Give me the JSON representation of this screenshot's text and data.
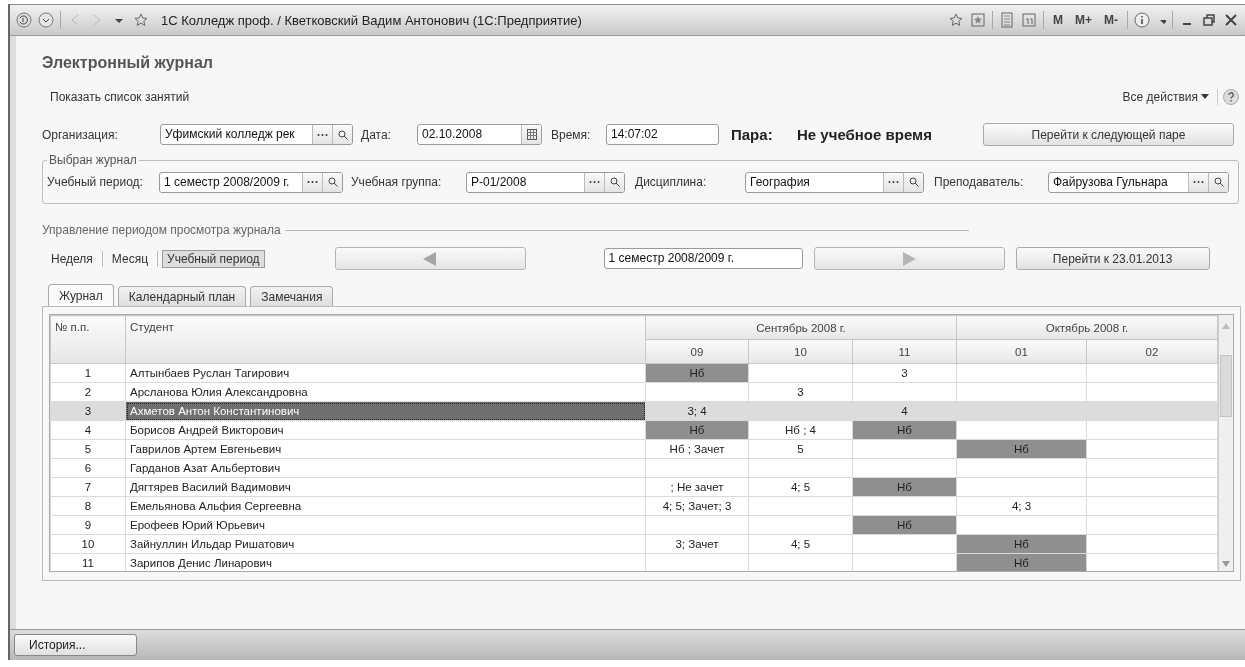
{
  "window": {
    "title": "1С Колледж проф. / Кветковский Вадим Антонович  (1С:Предприятие)",
    "memory_buttons": [
      "M",
      "M+",
      "M-"
    ]
  },
  "form": {
    "title": "Электронный журнал",
    "show_list_link": "Показать список занятий",
    "all_actions": "Все действия",
    "organization": {
      "label": "Организация:",
      "value": "Уфимский колледж рек"
    },
    "date": {
      "label": "Дата:",
      "value": "02.10.2008"
    },
    "time": {
      "label": "Время:",
      "value": "14:07:02"
    },
    "pair": {
      "label": "Пара:",
      "value": "Не учебное время"
    },
    "next_pair_button": "Перейти к следующей паре",
    "journal_group": {
      "title": "Выбран журнал",
      "fields": [
        {
          "label": "Учебный период:",
          "value": "1 семестр 2008/2009 г."
        },
        {
          "label": "Учебная группа:",
          "value": "Р-01/2008"
        },
        {
          "label": "Дисциплина:",
          "value": "География"
        },
        {
          "label": "Преподаватель:",
          "value": "Файрузова Гульнара"
        }
      ]
    },
    "period_group": {
      "title": "Управление периодом просмотра журнала",
      "modes": [
        {
          "label": "Неделя",
          "selected": false
        },
        {
          "label": "Месяц",
          "selected": false
        },
        {
          "label": "Учебный период",
          "selected": true
        }
      ],
      "period_value": "1 семестр 2008/2009 г.",
      "goto_button": "Перейти к 23.01.2013"
    },
    "tabs": [
      {
        "label": "Журнал",
        "selected": true
      },
      {
        "label": "Календарный план",
        "selected": false
      },
      {
        "label": "Замечания",
        "selected": false
      }
    ]
  },
  "grid": {
    "columns": [
      "№ п.п.",
      "Студент"
    ],
    "months": [
      {
        "label": "Сентябрь 2008 г.",
        "days": [
          "09",
          "10",
          "11"
        ]
      },
      {
        "label": "Октябрь 2008 г.",
        "days": [
          "01",
          "02"
        ]
      }
    ],
    "rows": [
      {
        "number": "1",
        "student": "Алтынбаев Руслан Тагирович",
        "selected": false,
        "cells": [
          {
            "text": "Нб",
            "highlighted": true
          },
          {
            "text": "",
            "highlighted": false
          },
          {
            "text": "3",
            "highlighted": false
          },
          {
            "text": "",
            "highlighted": false
          },
          {
            "text": "",
            "highlighted": false
          }
        ]
      },
      {
        "number": "2",
        "student": "Арсланова Юлия Александровна",
        "selected": false,
        "cells": [
          {
            "text": "",
            "highlighted": false
          },
          {
            "text": "3",
            "highlighted": false
          },
          {
            "text": "",
            "highlighted": false
          },
          {
            "text": "",
            "highlighted": false
          },
          {
            "text": "",
            "highlighted": false
          }
        ]
      },
      {
        "number": "3",
        "student": "Ахметов Антон Константинович",
        "selected": true,
        "cells": [
          {
            "text": "3; 4",
            "highlighted": false
          },
          {
            "text": "",
            "highlighted": false
          },
          {
            "text": "4",
            "highlighted": false
          },
          {
            "text": "",
            "highlighted": false
          },
          {
            "text": "",
            "highlighted": false
          }
        ]
      },
      {
        "number": "4",
        "student": "Борисов Андрей Викторович",
        "selected": false,
        "cells": [
          {
            "text": "Нб",
            "highlighted": true
          },
          {
            "text": "Нб ; 4",
            "highlighted": false
          },
          {
            "text": "Нб",
            "highlighted": true
          },
          {
            "text": "",
            "highlighted": false
          },
          {
            "text": "",
            "highlighted": false
          }
        ]
      },
      {
        "number": "5",
        "student": "Гаврилов Артем Евгеньевич",
        "selected": false,
        "cells": [
          {
            "text": "Нб ; Зачет",
            "highlighted": false
          },
          {
            "text": "5",
            "highlighted": false
          },
          {
            "text": "",
            "highlighted": false
          },
          {
            "text": "Нб",
            "highlighted": true
          },
          {
            "text": "",
            "highlighted": false
          }
        ]
      },
      {
        "number": "6",
        "student": "Гарданов Азат Альбертович",
        "selected": false,
        "cells": [
          {
            "text": "",
            "highlighted": false
          },
          {
            "text": "",
            "highlighted": false
          },
          {
            "text": "",
            "highlighted": false
          },
          {
            "text": "",
            "highlighted": false
          },
          {
            "text": "",
            "highlighted": false
          }
        ]
      },
      {
        "number": "7",
        "student": "Дягтярев Василий Вадимович",
        "selected": false,
        "cells": [
          {
            "text": "; Не зачет",
            "highlighted": false
          },
          {
            "text": "4; 5",
            "highlighted": false
          },
          {
            "text": "Нб",
            "highlighted": true
          },
          {
            "text": "",
            "highlighted": false
          },
          {
            "text": "",
            "highlighted": false
          }
        ]
      },
      {
        "number": "8",
        "student": "Емельянова Альфия Сергеевна",
        "selected": false,
        "cells": [
          {
            "text": "4; 5; Зачет; 3",
            "highlighted": false
          },
          {
            "text": "",
            "highlighted": false
          },
          {
            "text": "",
            "highlighted": false
          },
          {
            "text": "4; 3",
            "highlighted": false
          },
          {
            "text": "",
            "highlighted": false
          }
        ]
      },
      {
        "number": "9",
        "student": "Ерофеев Юрий Юрьевич",
        "selected": false,
        "cells": [
          {
            "text": "",
            "highlighted": false
          },
          {
            "text": "",
            "highlighted": false
          },
          {
            "text": "Нб",
            "highlighted": true
          },
          {
            "text": "",
            "highlighted": false
          },
          {
            "text": "",
            "highlighted": false
          }
        ]
      },
      {
        "number": "10",
        "student": "Зайнуллин Ильдар Ришатович",
        "selected": false,
        "cells": [
          {
            "text": "3; Зачет",
            "highlighted": false
          },
          {
            "text": "4; 5",
            "highlighted": false
          },
          {
            "text": "",
            "highlighted": false
          },
          {
            "text": "Нб",
            "highlighted": true
          },
          {
            "text": "",
            "highlighted": false
          }
        ]
      },
      {
        "number": "11",
        "student": "Зарипов Денис Линарович",
        "selected": false,
        "cells": [
          {
            "text": "",
            "highlighted": false
          },
          {
            "text": "",
            "highlighted": false
          },
          {
            "text": "",
            "highlighted": false
          },
          {
            "text": "Нб",
            "highlighted": true
          },
          {
            "text": "",
            "highlighted": false
          }
        ]
      }
    ]
  },
  "status_bar": {
    "history_button": "История..."
  }
}
